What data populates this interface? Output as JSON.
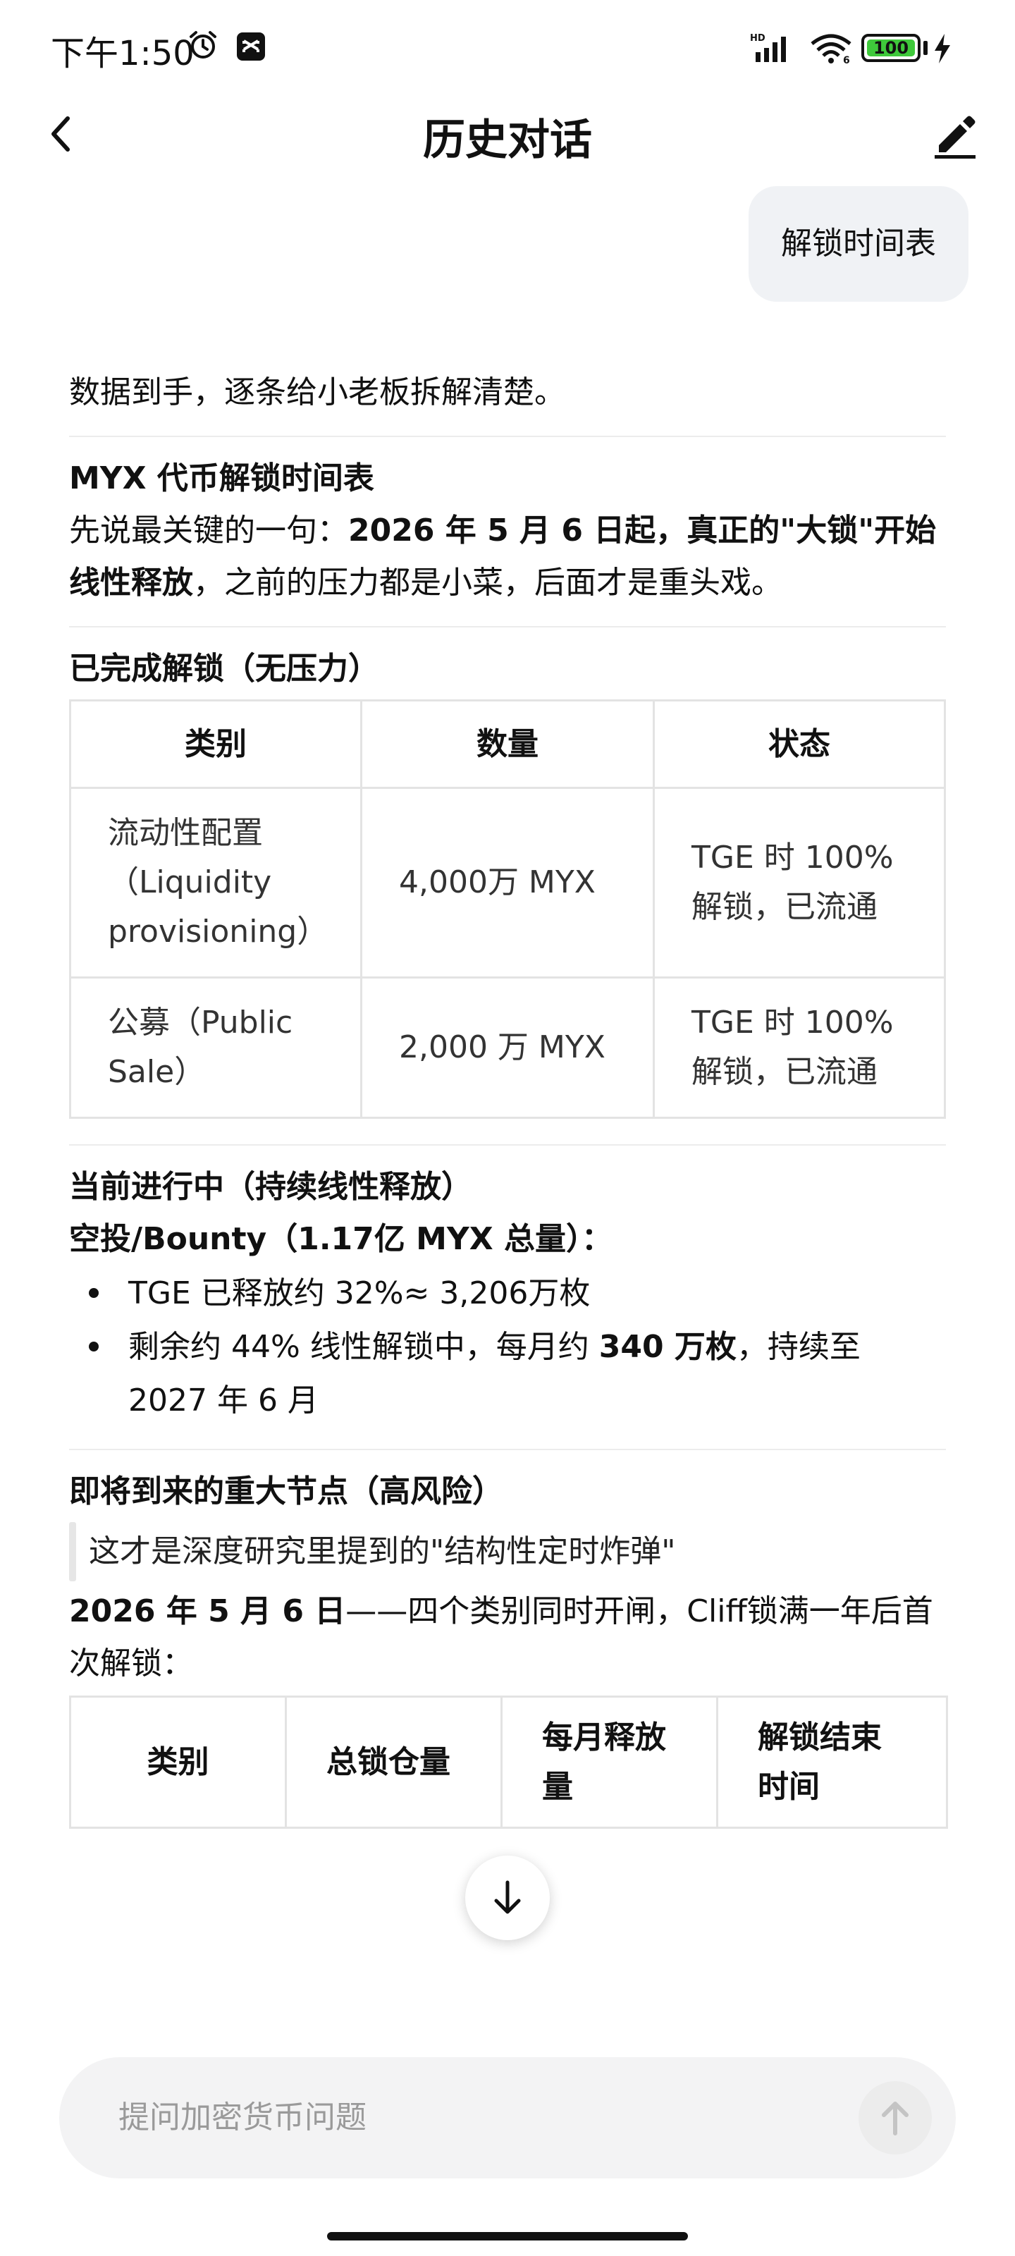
{
  "status_bar": {
    "time": "下午1:50",
    "signal_label": "HD",
    "wifi_label": "6",
    "battery": "100"
  },
  "header": {
    "title": "历史对话"
  },
  "user_message": "解锁时间表",
  "answer": {
    "intro": "数据到手，逐条给小老板拆解清楚。",
    "title": "MYX 代币解锁时间表",
    "key_prefix": "先说最关键的一句：",
    "key_bold": "2026 年 5 月 6 日起，真正的\"大锁\"开始线性释放",
    "key_suffix": "，之前的压力都是小菜，后面才是重头戏。",
    "completed": {
      "title": "已完成解锁（无压力）",
      "headers": [
        "类别",
        "数量",
        "状态"
      ],
      "rows": [
        {
          "category": "流动性配置（Liquidity provisioning）",
          "amount": "4,000万 MYX",
          "status": "TGE 时 100% 解锁，已流通"
        },
        {
          "category": "公募（Public Sale）",
          "amount": "2,000 万 MYX",
          "status": "TGE 时 100% 解锁，已流通"
        }
      ]
    },
    "ongoing": {
      "title": "当前进行中（持续线性释放）",
      "subtitle": "空投/Bounty（1.17亿 MYX 总量）：",
      "bullet1": "TGE 已释放约 32%≈ 3,206万枚",
      "bullet2_prefix": "剩余约 44% 线性解锁中，每月约 ",
      "bullet2_bold": "340 万枚",
      "bullet2_suffix": "，持续至 2027 年 6 月"
    },
    "upcoming": {
      "title": "即将到来的重大节点（高风险）",
      "quote": "这才是深度研究里提到的\"结构性定时炸弹\"",
      "date_bold": "2026 年 5 月 6 日",
      "date_text": "——四个类别同时开闸，Cliff锁满一年后首次解锁：",
      "headers": [
        "类别",
        "总锁仓量",
        "每月释放量",
        "解锁结束时间"
      ]
    }
  },
  "input": {
    "placeholder": "提问加密货币问题"
  }
}
